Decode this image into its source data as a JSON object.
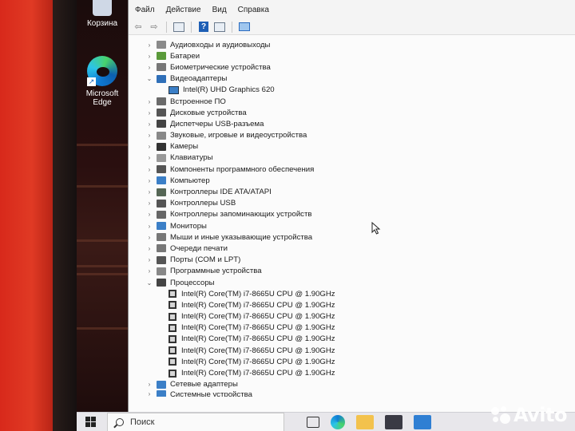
{
  "desktop": {
    "icons": [
      {
        "label": "Корзина"
      },
      {
        "label_line1": "Microsoft",
        "label_line2": "Edge"
      }
    ]
  },
  "window": {
    "menu": [
      "Файл",
      "Действие",
      "Вид",
      "Справка"
    ],
    "toolbar_icons": [
      "back-arrow-icon",
      "forward-arrow-icon",
      "properties-icon",
      "help-icon",
      "view-icon",
      "scan-monitor-icon"
    ],
    "tree": [
      {
        "label": "Аудиовходы и аудиовыходы",
        "expanded": false,
        "icon_color": "#8a8a8a"
      },
      {
        "label": "Батареи",
        "expanded": false,
        "icon_color": "#5a9a3a"
      },
      {
        "label": "Биометрические устройства",
        "expanded": false,
        "icon_color": "#777777"
      },
      {
        "label": "Видеоадаптеры",
        "expanded": true,
        "icon_color": "#2f6fb8",
        "children": [
          "Intel(R) UHD Graphics 620"
        ]
      },
      {
        "label": "Встроенное ПО",
        "expanded": false,
        "icon_color": "#6a6a6a"
      },
      {
        "label": "Дисковые устройства",
        "expanded": false,
        "icon_color": "#555555"
      },
      {
        "label": "Диспетчеры USB-разъема",
        "expanded": false,
        "icon_color": "#444444"
      },
      {
        "label": "Звуковые, игровые и видеоустройства",
        "expanded": false,
        "icon_color": "#888888"
      },
      {
        "label": "Камеры",
        "expanded": false,
        "icon_color": "#333333"
      },
      {
        "label": "Клавиатуры",
        "expanded": false,
        "icon_color": "#999999"
      },
      {
        "label": "Компоненты программного обеспечения",
        "expanded": false,
        "icon_color": "#555555"
      },
      {
        "label": "Компьютер",
        "expanded": false,
        "icon_color": "#3b7fc7"
      },
      {
        "label": "Контроллеры IDE ATA/ATAPI",
        "expanded": false,
        "icon_color": "#556655"
      },
      {
        "label": "Контроллеры USB",
        "expanded": false,
        "icon_color": "#555555"
      },
      {
        "label": "Контроллеры запоминающих устройств",
        "expanded": false,
        "icon_color": "#666666"
      },
      {
        "label": "Мониторы",
        "expanded": false,
        "icon_color": "#3b7fc7"
      },
      {
        "label": "Мыши и иные указывающие устройства",
        "expanded": false,
        "icon_color": "#777777"
      },
      {
        "label": "Очереди печати",
        "expanded": false,
        "icon_color": "#777777"
      },
      {
        "label": "Порты (COM и LPT)",
        "expanded": false,
        "icon_color": "#555555"
      },
      {
        "label": "Программные устройства",
        "expanded": false,
        "icon_color": "#888888"
      },
      {
        "label": "Процессоры",
        "expanded": true,
        "icon_color": "#444444",
        "children": [
          "Intel(R) Core(TM) i7-8665U CPU @ 1.90GHz",
          "Intel(R) Core(TM) i7-8665U CPU @ 1.90GHz",
          "Intel(R) Core(TM) i7-8665U CPU @ 1.90GHz",
          "Intel(R) Core(TM) i7-8665U CPU @ 1.90GHz",
          "Intel(R) Core(TM) i7-8665U CPU @ 1.90GHz",
          "Intel(R) Core(TM) i7-8665U CPU @ 1.90GHz",
          "Intel(R) Core(TM) i7-8665U CPU @ 1.90GHz",
          "Intel(R) Core(TM) i7-8665U CPU @ 1.90GHz"
        ]
      },
      {
        "label": "Сетевые адаптеры",
        "expanded": false,
        "icon_color": "#3b7fc7"
      },
      {
        "label": "Системные устройства",
        "expanded": false,
        "icon_color": "#3b7fc7",
        "partially_visible": true
      }
    ]
  },
  "taskbar": {
    "search_placeholder": "Поиск",
    "apps": [
      "task-view-icon",
      "edge-icon",
      "file-explorer-icon",
      "store-icon",
      "mail-icon"
    ]
  },
  "watermark": {
    "text": "Avito"
  }
}
